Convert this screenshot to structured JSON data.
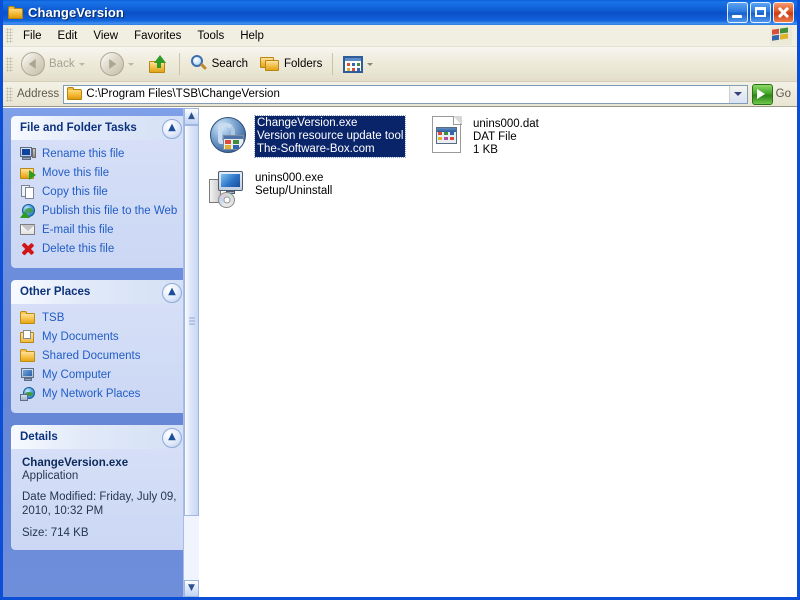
{
  "window": {
    "title": "ChangeVersion",
    "icon": "folder-icon",
    "controls": {
      "minimize": "minimize-button",
      "maximize": "maximize-button",
      "close": "close-button"
    }
  },
  "menubar": {
    "items": [
      {
        "label": "File"
      },
      {
        "label": "Edit"
      },
      {
        "label": "View"
      },
      {
        "label": "Favorites"
      },
      {
        "label": "Tools"
      },
      {
        "label": "Help"
      }
    ],
    "logo": "windows-flag-icon"
  },
  "toolbar": {
    "back_label": "Back",
    "forward_label": "",
    "up_label": "",
    "search_label": "Search",
    "folders_label": "Folders",
    "views_label": ""
  },
  "address": {
    "label": "Address",
    "value": "C:\\Program Files\\TSB\\ChangeVersion",
    "placeholder": "",
    "go_label": "Go"
  },
  "sidebar": {
    "panels": [
      {
        "title": "File and Folder Tasks",
        "items": [
          {
            "label": "Rename this file",
            "icon": "rename-icon"
          },
          {
            "label": "Move this file",
            "icon": "move-icon"
          },
          {
            "label": "Copy this file",
            "icon": "copy-icon"
          },
          {
            "label": "Publish this file to the Web",
            "icon": "publish-web-icon"
          },
          {
            "label": "E-mail this file",
            "icon": "email-icon"
          },
          {
            "label": "Delete this file",
            "icon": "delete-icon"
          }
        ]
      },
      {
        "title": "Other Places",
        "items": [
          {
            "label": "TSB",
            "icon": "folder-icon"
          },
          {
            "label": "My Documents",
            "icon": "my-documents-icon"
          },
          {
            "label": "Shared Documents",
            "icon": "folder-icon"
          },
          {
            "label": "My Computer",
            "icon": "my-computer-icon"
          },
          {
            "label": "My Network Places",
            "icon": "network-places-icon"
          }
        ]
      },
      {
        "title": "Details",
        "file_name": "ChangeVersion.exe",
        "file_type": "Application",
        "date_modified": "Date Modified: Friday, July 09, 2010, 10:32 PM",
        "size": "Size: 714 KB"
      }
    ]
  },
  "files": [
    {
      "name": "ChangeVersion.exe",
      "line2": "Version resource update tool",
      "line3": "The-Software-Box.com",
      "icon": "changeversion-app-icon",
      "selected": true
    },
    {
      "name": "unins000.dat",
      "line2": "DAT File",
      "line3": "1 KB",
      "icon": "dat-file-icon",
      "selected": false
    },
    {
      "name": "unins000.exe",
      "line2": "Setup/Uninstall",
      "line3": "",
      "icon": "setup-uninstall-icon",
      "selected": false
    }
  ],
  "colors": {
    "title_blue": "#0A50C8",
    "frame_blue": "#0A4FD6",
    "sidebar_blue": "#6585D6",
    "panel_body": "#D0DAF5",
    "link_blue": "#215DC6",
    "selection": "#0A246A",
    "heading_blue": "#0C327D",
    "go_green": "#3FA528"
  }
}
